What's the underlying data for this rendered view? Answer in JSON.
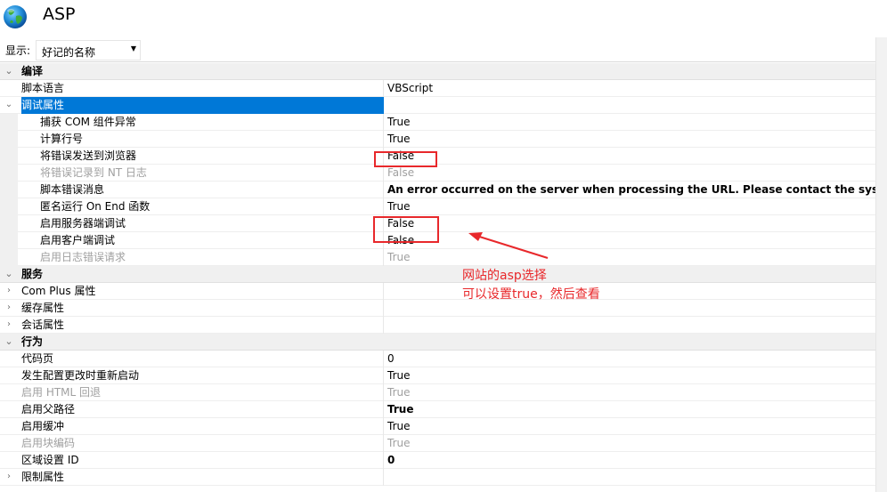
{
  "header": {
    "title": "ASP",
    "icon": "globe-icon"
  },
  "toolbar": {
    "show_label": "显示:",
    "show_value": "好记的名称"
  },
  "grid": {
    "rows": [
      {
        "type": "category",
        "name": "编译",
        "expander": "expanded"
      },
      {
        "type": "prop",
        "name": "脚本语言",
        "value": "VBScript"
      },
      {
        "type": "category-selected",
        "name": "调试属性",
        "expander": "expanded"
      },
      {
        "type": "child",
        "name": "捕获 COM 组件异常",
        "value": "True"
      },
      {
        "type": "child",
        "name": "计算行号",
        "value": "True"
      },
      {
        "type": "child",
        "name": "将错误发送到浏览器",
        "value": "False"
      },
      {
        "type": "child-disabled",
        "name": "将错误记录到 NT 日志",
        "value": "False"
      },
      {
        "type": "child",
        "name": "脚本错误消息",
        "value": "An error occurred on the server when processing the URL. Please contact the system adm",
        "bold": true
      },
      {
        "type": "child",
        "name": "匿名运行 On End 函数",
        "value": "True"
      },
      {
        "type": "child",
        "name": "启用服务器端调试",
        "value": "False"
      },
      {
        "type": "child",
        "name": "启用客户端调试",
        "value": "False"
      },
      {
        "type": "child-disabled",
        "name": "启用日志错误请求",
        "value": "True"
      },
      {
        "type": "category",
        "name": "服务",
        "expander": "expanded"
      },
      {
        "type": "collapsed",
        "name": "Com Plus 属性",
        "value": ""
      },
      {
        "type": "collapsed",
        "name": "缓存属性",
        "value": ""
      },
      {
        "type": "collapsed",
        "name": "会话属性",
        "value": ""
      },
      {
        "type": "category",
        "name": "行为",
        "expander": "expanded"
      },
      {
        "type": "prop",
        "name": "代码页",
        "value": "0"
      },
      {
        "type": "prop",
        "name": "发生配置更改时重新启动",
        "value": "True"
      },
      {
        "type": "prop-disabled",
        "name": "启用 HTML 回退",
        "value": "True"
      },
      {
        "type": "prop",
        "name": "启用父路径",
        "value": "True",
        "bold": true
      },
      {
        "type": "prop",
        "name": "启用缓冲",
        "value": "True"
      },
      {
        "type": "prop-disabled",
        "name": "启用块编码",
        "value": "True"
      },
      {
        "type": "prop",
        "name": "区域设置 ID",
        "value": "0",
        "bold": true
      },
      {
        "type": "collapsed",
        "name": "限制属性",
        "value": ""
      }
    ]
  },
  "annotation": {
    "line1": "网站的asp选择",
    "line2": "可以设置true，然后查看",
    "color": "#e8282b"
  }
}
